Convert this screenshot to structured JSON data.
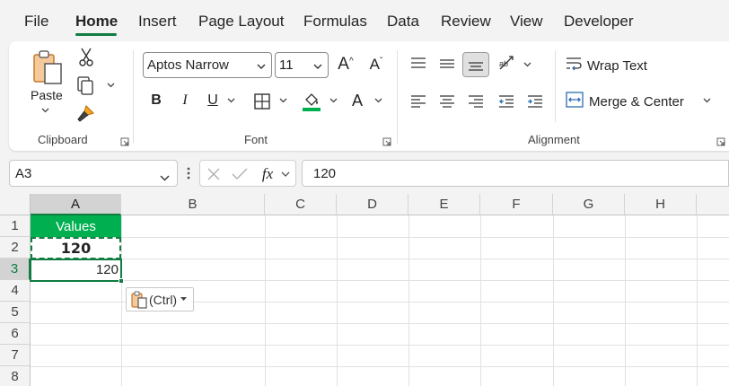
{
  "menu": {
    "tabs": [
      {
        "label": "File"
      },
      {
        "label": "Home"
      },
      {
        "label": "Insert"
      },
      {
        "label": "Page Layout"
      },
      {
        "label": "Formulas"
      },
      {
        "label": "Data"
      },
      {
        "label": "Review"
      },
      {
        "label": "View"
      },
      {
        "label": "Developer"
      }
    ],
    "active": "Home"
  },
  "ribbon": {
    "clipboard": {
      "label": "Clipboard",
      "paste_label": "Paste"
    },
    "font": {
      "label": "Font",
      "font_name": "Aptos Narrow",
      "font_size": "11",
      "bold": "B",
      "italic": "I",
      "underline": "U"
    },
    "alignment": {
      "label": "Alignment",
      "wrap_text": "Wrap Text",
      "merge_center": "Merge & Center"
    }
  },
  "formula_bar": {
    "name_box": "A3",
    "fx": "fx",
    "value": "120"
  },
  "sheet": {
    "columns": [
      "A",
      "B",
      "C",
      "D",
      "E",
      "F",
      "G",
      "H"
    ],
    "rows": [
      "1",
      "2",
      "3",
      "4",
      "5",
      "6",
      "7",
      "8"
    ],
    "cells": {
      "A1": "Values",
      "A2": "120",
      "A3": "120"
    },
    "paste_options_label": "(Ctrl)"
  },
  "colors": {
    "accent": "#107c41",
    "header_fill": "#00b050",
    "header_text": "#ffffff"
  }
}
